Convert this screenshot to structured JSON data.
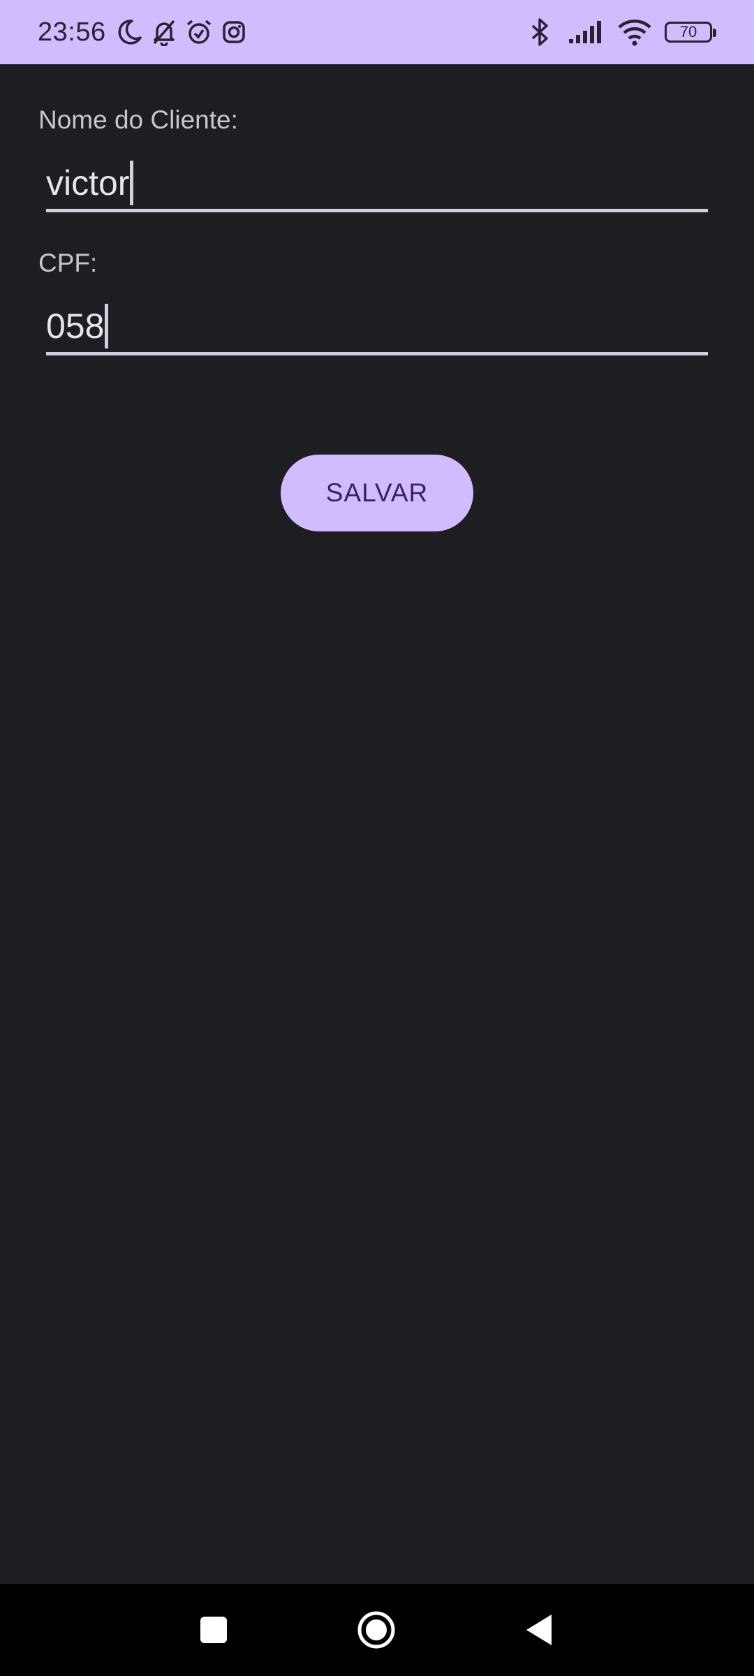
{
  "status_bar": {
    "time": "23:56",
    "battery_level": "70",
    "left_icons": [
      "moon-icon",
      "bell-off-icon",
      "alarm-icon",
      "instagram-icon"
    ],
    "right_icons": [
      "bluetooth-icon",
      "signal-icon",
      "wifi-icon",
      "battery-icon"
    ]
  },
  "form": {
    "name_label": "Nome do Cliente:",
    "name_value": "victor",
    "cpf_label": "CPF:",
    "cpf_value": "058",
    "save_label": "SALVAR"
  },
  "nav_bar": {
    "buttons": [
      "recents-button",
      "home-button",
      "back-button"
    ]
  },
  "colors": {
    "accent": "#d0bcfe",
    "background": "#1e1d21",
    "button_text": "#3a1f6e"
  }
}
